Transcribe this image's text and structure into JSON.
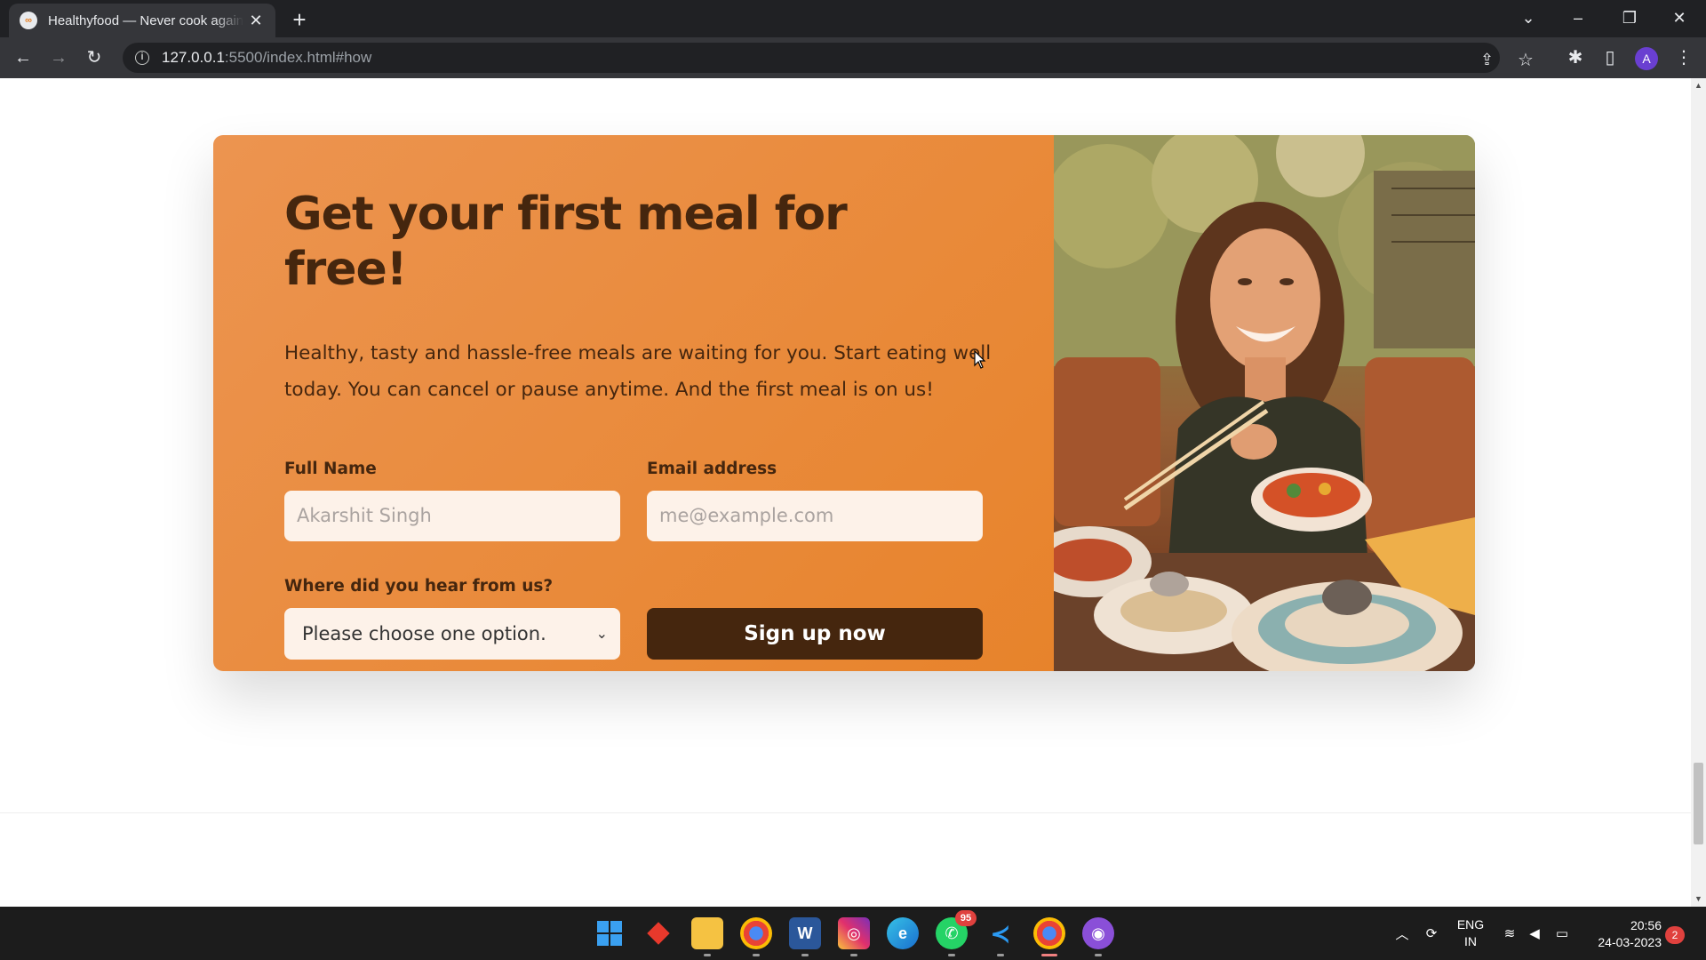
{
  "browser": {
    "tab_title": "Healthyfood — Never cook again!",
    "tab_favicon_text": "∞",
    "new_tab_symbol": "+",
    "url_host": "127.0.0.1",
    "url_rest": ":5500/index.html#how",
    "profile_initial": "A"
  },
  "cta": {
    "title": "Get your first meal for free!",
    "description": "Healthy, tasty and hassle-free meals are waiting for you. Start eating well today. You can cancel or pause anytime. And the first meal is on us!",
    "full_name_label": "Full Name",
    "full_name_placeholder": "Akarshit Singh",
    "email_label": "Email address",
    "email_placeholder": "me@example.com",
    "source_label": "Where did you hear from us?",
    "source_selected": "Please choose one option.",
    "signup_label": "Sign up now",
    "image_alt": "Woman enjoying food, meals in storage container, and food bowls on a table",
    "accent_color": "#e67e22",
    "dark_color": "#45260e"
  },
  "taskbar": {
    "apps": [
      {
        "name": "start-icon"
      },
      {
        "name": "git-icon"
      },
      {
        "name": "file-explorer-icon"
      },
      {
        "name": "chrome-icon"
      },
      {
        "name": "word-icon"
      },
      {
        "name": "instagram-icon"
      },
      {
        "name": "edge-icon"
      },
      {
        "name": "whatsapp-icon",
        "badge": "95"
      },
      {
        "name": "vscode-icon"
      },
      {
        "name": "chrome-profile-icon"
      },
      {
        "name": "github-desktop-icon"
      }
    ],
    "lang_line1": "ENG",
    "lang_line2": "IN",
    "time": "20:56",
    "date": "24-03-2023",
    "notification_count": "2"
  }
}
